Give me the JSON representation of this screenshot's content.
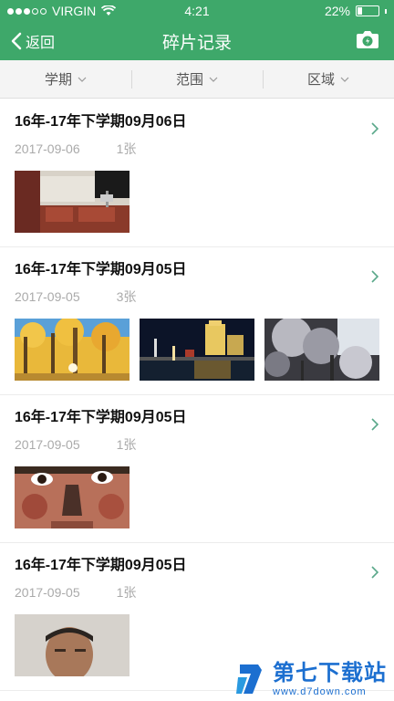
{
  "status_bar": {
    "carrier": "VIRGIN",
    "time": "4:21",
    "battery": "22%",
    "battery_level": 0.22
  },
  "nav": {
    "back_label": "返回",
    "title": "碎片记录",
    "camera_icon": "camera-icon"
  },
  "filters": [
    {
      "label": "学期"
    },
    {
      "label": "范围"
    },
    {
      "label": "区域"
    }
  ],
  "records": [
    {
      "title": "16年-17年下学期09月06日",
      "date": "2017-09-06",
      "count": "1张",
      "photos": [
        "photo-classroom-interior"
      ]
    },
    {
      "title": "16年-17年下学期09月05日",
      "date": "2017-09-05",
      "count": "3张",
      "photos": [
        "photo-autumn-trees",
        "photo-night-city-bridge",
        "photo-cherry-blossom-tree"
      ]
    },
    {
      "title": "16年-17年下学期09月05日",
      "date": "2017-09-05",
      "count": "1张",
      "photos": [
        "photo-child-face"
      ]
    },
    {
      "title": "16年-17年下学期09月05日",
      "date": "2017-09-05",
      "count": "1张",
      "photos": [
        "photo-man-portrait"
      ]
    }
  ],
  "watermark": {
    "title": "第七下载站",
    "url": "www.d7down.com"
  },
  "colors": {
    "header": "#3ea86a",
    "chevron": "#5aa88a",
    "watermark": "#1c6fd0"
  }
}
